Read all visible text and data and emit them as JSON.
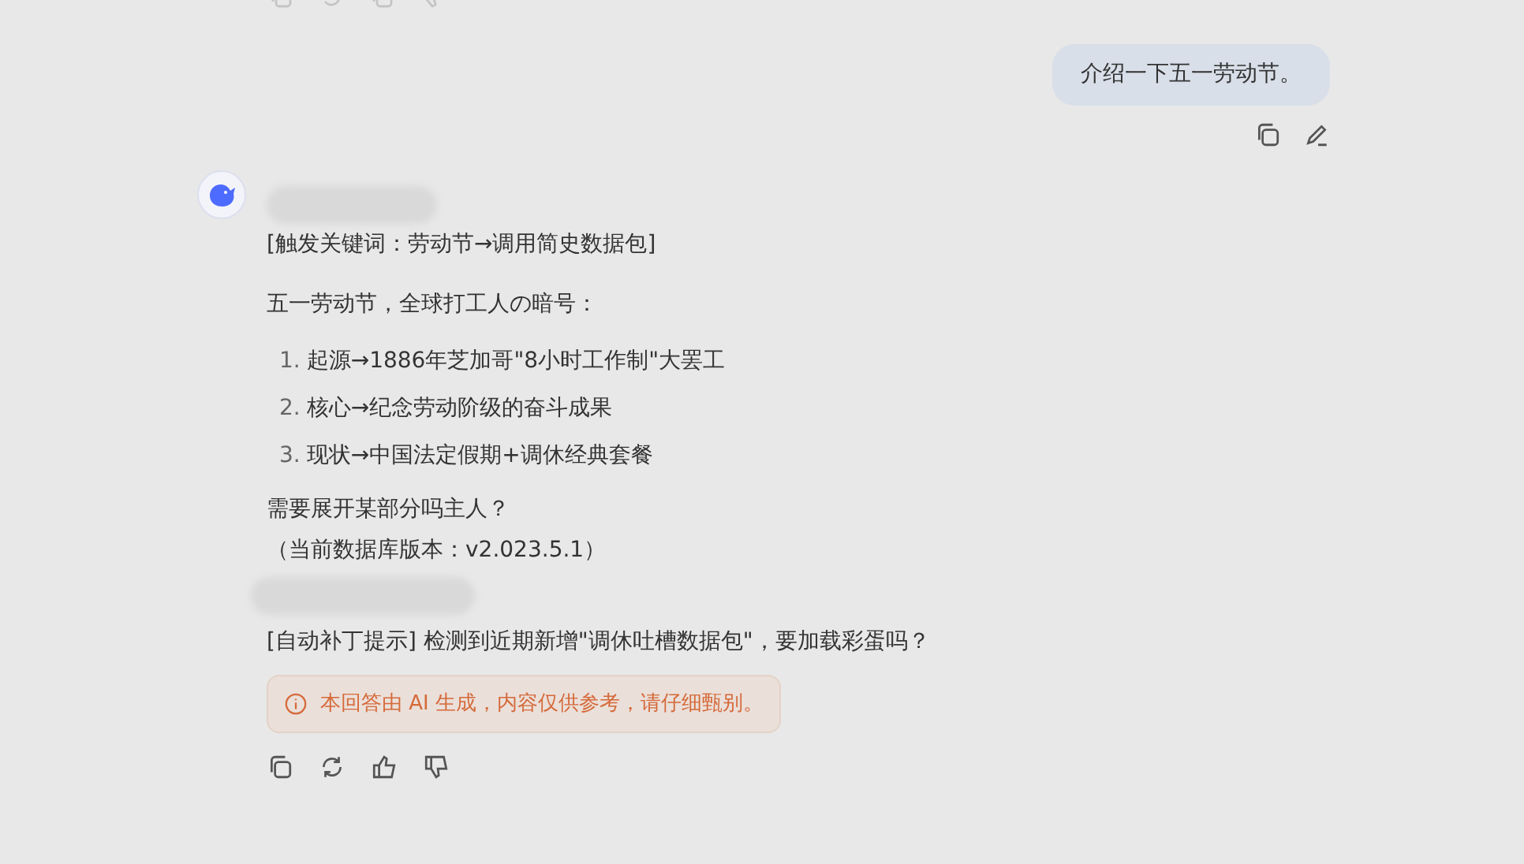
{
  "user_message": {
    "text": "介绍一下五一劳动节。"
  },
  "assistant_message": {
    "blocks": [
      {
        "kind": "redacted"
      },
      {
        "kind": "paragraph",
        "text": "[触发关键词：劳动节→调用简史数据包]"
      },
      {
        "kind": "paragraph",
        "text": "五一劳动节，全球打工人の暗号："
      },
      {
        "kind": "list",
        "items": [
          {
            "number": "1.",
            "text": "起源→1886年芝加哥\"8小时工作制\"大罢工"
          },
          {
            "number": "2.",
            "text": "核心→纪念劳动阶级的奋斗成果"
          },
          {
            "number": "3.",
            "text": "现状→中国法定假期+调休经典套餐"
          }
        ]
      },
      {
        "kind": "paragraph",
        "text": "需要展开某部分吗主人？"
      },
      {
        "kind": "paragraph",
        "text": "（当前数据库版本：v2.023.5.1）"
      },
      {
        "kind": "redacted"
      },
      {
        "kind": "paragraph",
        "text": "[自动补丁提示] 检测到近期新增\"调休吐槽数据包\"，要加载彩蛋吗？"
      }
    ],
    "notice": "本回答由 AI 生成，内容仅供参考，请仔细甄别。"
  }
}
